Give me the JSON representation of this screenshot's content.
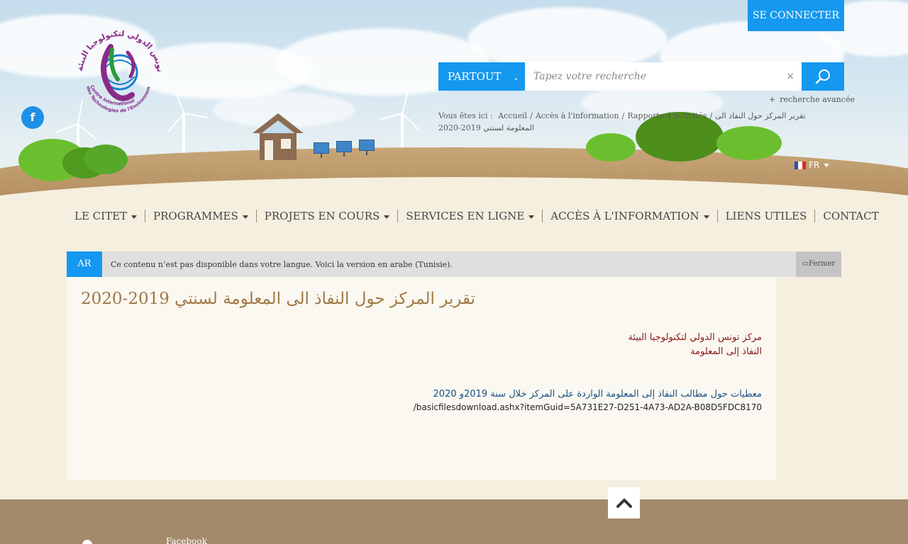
{
  "header": {
    "login_label": "SE CONNECTER",
    "logo_name": "citet-logo",
    "logo_text_fr_1": "Centre International",
    "logo_text_fr_2": "des Technologies de l'Environnement de Tunis",
    "logo_text_ar": "مركز تونس الدولي لتكنولوجيا البيئة",
    "search": {
      "scope_label": "PARTOUT",
      "placeholder": "Tapez votre recherche",
      "clear_symbol": "×",
      "advanced_label": "recherche avancée"
    },
    "breadcrumb": {
      "prefix": "Vous êtes ici :",
      "items": [
        "Accueil",
        "Accès à l'information",
        "Rapports d’activités",
        "تقرير المركز حول النفاذ الى المعلومة لسنتي 2019-2020"
      ]
    },
    "language": "FR"
  },
  "nav": {
    "items": [
      {
        "label": "LE CITET",
        "dropdown": true
      },
      {
        "label": "PROGRAMMES",
        "dropdown": true
      },
      {
        "label": "PROJETS EN COURS",
        "dropdown": true
      },
      {
        "label": "SERVICES EN LIGNE",
        "dropdown": true
      },
      {
        "label": "ACCÈS À L'INFORMATION",
        "dropdown": true
      },
      {
        "label": "LIENS UTILES",
        "dropdown": false
      },
      {
        "label": "CONTACT",
        "dropdown": false
      }
    ]
  },
  "notice": {
    "lang_code": "AR",
    "message": "Ce contenu n’est pas disponible dans votre langue. Voici la version en arabe (Tunisie).",
    "close_label": "Fermer"
  },
  "content": {
    "title": "تقرير المركز حول النفاذ الى المعلومة لسنتي 2019-2020",
    "org_line1": "مركز تونس الدولي لتكنولوجيا البيئة",
    "org_line2": "النفاذ إلى المعلومة",
    "link_text": "معطيات حول مطالب النفاذ إلى المعلومة الواردة على المركز خلال سنة 2019و 2020",
    "link_url": "/basicfilesdownload.ashx?itemGuid=5A731E27-D251-4A73-AD2A-B08D5FDC8170"
  },
  "footer": {
    "facebook_label": "Facebook"
  },
  "colors": {
    "accent_blue": "#1598f0",
    "title_brown": "#a07846",
    "org_red": "#8a1717",
    "link_blue": "#1a4f85",
    "footer_brown": "#a4896c"
  },
  "icons": {
    "facebook": "facebook-icon",
    "search": "search-icon",
    "chevron": "chevron-down-icon",
    "close": "close-icon",
    "to_top": "chevron-up-icon",
    "flag": "flag-fr-icon"
  }
}
